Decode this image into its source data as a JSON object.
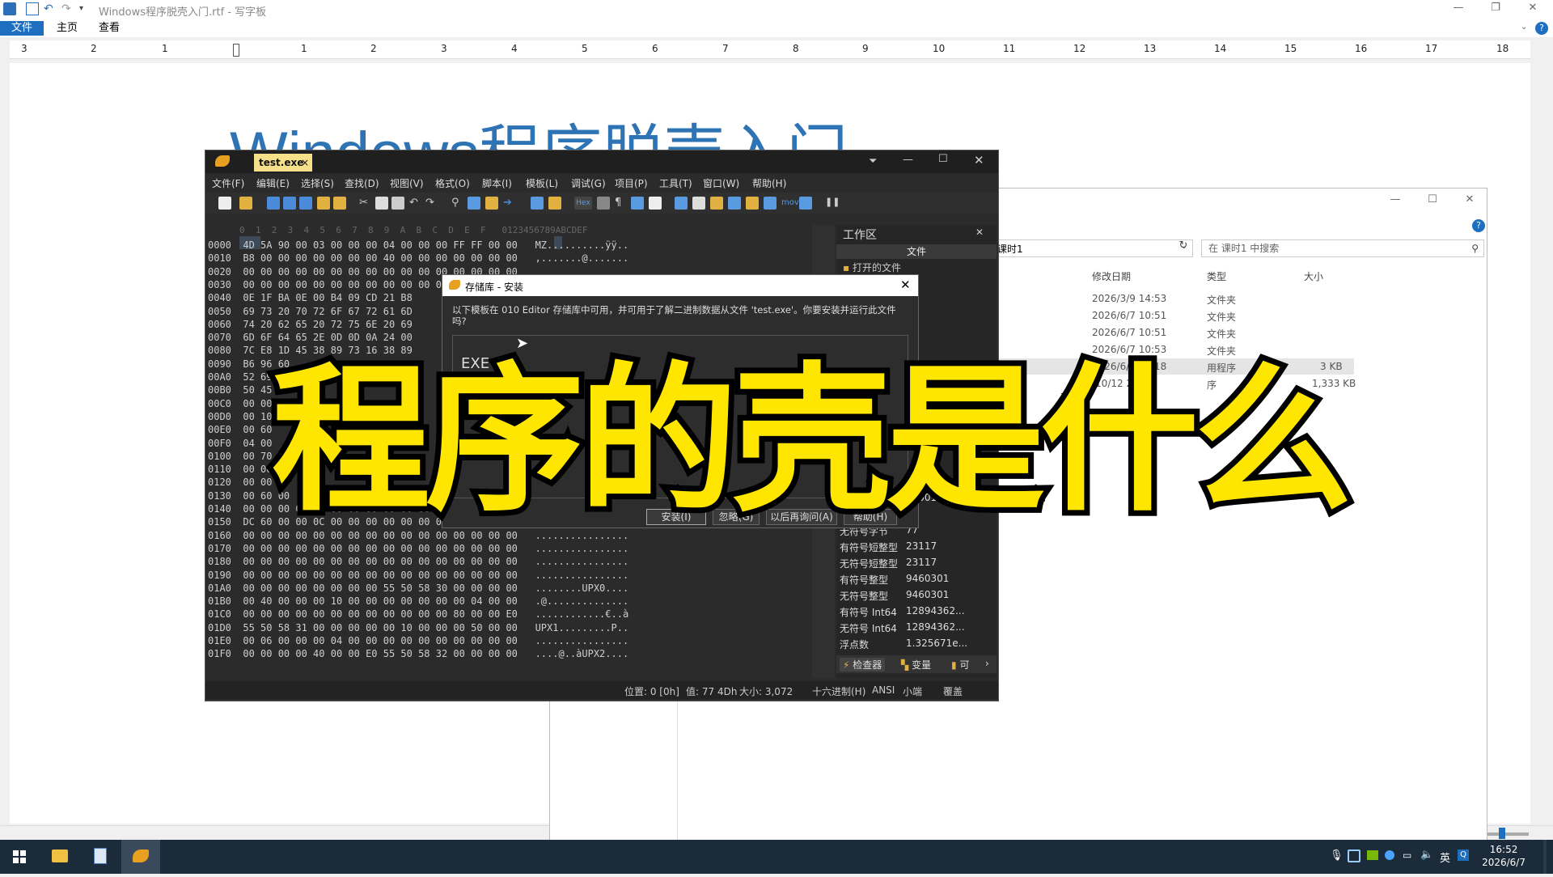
{
  "wordpad": {
    "title": "Windows程序脱壳入门.rtf - 写字板",
    "tabs": [
      "文件",
      "主页",
      "查看"
    ],
    "ruler_numbers": [
      "3",
      "2",
      "1",
      "1",
      "2",
      "3",
      "4",
      "5",
      "6",
      "7",
      "8",
      "9",
      "10",
      "11",
      "12",
      "13",
      "14",
      "15",
      "16",
      "17",
      "18"
    ],
    "doc_title": "Windows程序脱壳入门"
  },
  "explorer": {
    "breadcrumb": "课时1",
    "search_placeholder": "在 课时1 中搜索",
    "columns": [
      "修改日期",
      "类型",
      "大小"
    ],
    "rows": [
      {
        "date": "2026/3/9 14:53",
        "type": "文件夹",
        "size": ""
      },
      {
        "date": "2026/6/7 10:51",
        "type": "文件夹",
        "size": ""
      },
      {
        "date": "2026/6/7 10:51",
        "type": "文件夹",
        "size": ""
      },
      {
        "date": "2026/6/7 10:53",
        "type": "文件夹",
        "size": ""
      },
      {
        "date": "2026/6/7 10:18",
        "type": "用程序",
        "size": "3 KB"
      },
      {
        "date": "/10/12 22:46",
        "type": "序",
        "size": "1,333 KB"
      }
    ]
  },
  "editor": {
    "tab_label": "test.exe",
    "menu": [
      "文件(F)",
      "编辑(E)",
      "选择(S)",
      "查找(D)",
      "视图(V)",
      "格式(O)",
      "脚本(I)",
      "模板(L)",
      "调试(G)",
      "项目(P)",
      "工具(T)",
      "窗口(W)",
      "帮助(H)"
    ],
    "hex_header": "0  1  2  3  4  5  6  7  8  9  A  B  C  D  E  F   0123456789ABCDEF",
    "hex_rows": [
      "0000  4D 5A 90 00 03 00 00 00 04 00 00 00 FF FF 00 00   MZ..........ÿÿ..",
      "0010  B8 00 00 00 00 00 00 00 40 00 00 00 00 00 00 00   ,.......@.......",
      "0020  00 00 00 00 00 00 00 00 00 00 00 00 00 00 00 00",
      "0030  00 00 00 00 00 00 00 00 00 00 00 00 00 00 00 00",
      "0040  0E 1F BA 0E 00 B4 09 CD 21 B8",
      "0050  69 73 20 70 72 6F 67 72 61 6D",
      "0060  74 20 62 65 20 72 75 6E 20 69",
      "0070  6D 6F 64 65 2E 0D 0D 0A 24 00",
      "0080  7C E8 1D 45 38 89 73 16 38 89",
      "0090  B6 96 60",
      "00A0  52 69",
      "00B0  50 45",
      "00C0  00 00",
      "00D0  00 10",
      "00E0  00 60",
      "00F0  04 00",
      "0100  00 70",
      "0110  00 00",
      "0120  00 00",
      "0130  00 60 00",
      "0140  00 00 00 00 00 00 00 00 00 00 00 00",
      "0150  DC 60 00 00 0C 00 00 00 00 00 00 00",
      "0160  00 00 00 00 00 00 00 00 00 00 00 00 00 00 00 00   ................",
      "0170  00 00 00 00 00 00 00 00 00 00 00 00 00 00 00 00   ................",
      "0180  00 00 00 00 00 00 00 00 00 00 00 00 00 00 00 00   ................",
      "0190  00 00 00 00 00 00 00 00 00 00 00 00 00 00 00 00   ................",
      "01A0  00 00 00 00 00 00 00 00 55 50 58 30 00 00 00 00   ........UPX0....",
      "01B0  00 40 00 00 00 10 00 00 00 00 00 00 00 04 00 00   .@..............",
      "01C0  00 00 00 00 00 00 00 00 00 00 00 00 80 00 00 E0   ............€..à",
      "01D0  55 50 58 31 00 00 00 00 00 10 00 00 00 50 00 00   UPX1.........P..",
      "01E0  00 06 00 00 00 04 00 00 00 00 00 00 00 00 00 00   ................",
      "01F0  00 00 00 00 40 00 00 E0 55 50 58 32 00 00 00 00   ....@..àUPX2...."
    ],
    "workspace_title": "工作区",
    "workspace_files": "文件",
    "workspace_open": "打开的文件",
    "inspector": [
      {
        "k": "",
        "v": "01001101"
      },
      {
        "k": "",
        "v": "77"
      },
      {
        "k": "无符号字节",
        "v": "77"
      },
      {
        "k": "有符号短整型",
        "v": "23117"
      },
      {
        "k": "无符号短整型",
        "v": "23117"
      },
      {
        "k": "有符号整型",
        "v": "9460301"
      },
      {
        "k": "无符号整型",
        "v": "9460301"
      },
      {
        "k": "有符号 Int64",
        "v": "12894362..."
      },
      {
        "k": "无符号 Int64",
        "v": "12894362..."
      },
      {
        "k": "浮点数",
        "v": "1.325671e..."
      }
    ],
    "panel_tabs": [
      "检查器",
      "变量",
      "可"
    ],
    "status": {
      "position": "位置: 0 [0h]",
      "value": "值: 77 4Dh",
      "size": "大小: 3,072",
      "mode": "十六进制(H)",
      "encoding": "ANSI",
      "endian": "小端",
      "overwrite": "覆盖"
    }
  },
  "dialog": {
    "title": "存储库 - 安装",
    "message": "以下模板在 010 Editor 存储库中可用，并可用于了解二进制数据从文件 'test.exe'。你要安装并运行此文件吗?",
    "box_text": "EXE",
    "buttons": [
      "安装(I)",
      "忽略(G)",
      "以后再询问(A)",
      "帮助(H)"
    ]
  },
  "overlay": {
    "text": "程序的壳是什么",
    "color": "#ffe600"
  },
  "taskbar": {
    "ime": "英",
    "time": "16:52",
    "date": "2026/6/7"
  }
}
